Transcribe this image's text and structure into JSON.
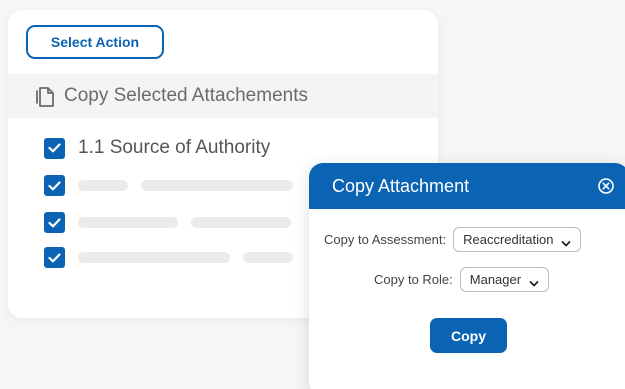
{
  "toolbar": {
    "select_action_label": "Select Action"
  },
  "copy_bar": {
    "label": "Copy Selected Attachements",
    "icon": "copy-document-icon"
  },
  "list": {
    "items": [
      {
        "label": "1.1 Source of Authority",
        "checked": true
      }
    ]
  },
  "dialog": {
    "title": "Copy Attachment",
    "assessment_label": "Copy to Assessment:",
    "assessment_value": "Reaccreditation",
    "role_label": "Copy to Role:",
    "role_value": "Manager",
    "copy_label": "Copy"
  },
  "colors": {
    "accent": "#0b64b3",
    "background": "#f6f6f6",
    "placeholder": "#ebebeb"
  }
}
